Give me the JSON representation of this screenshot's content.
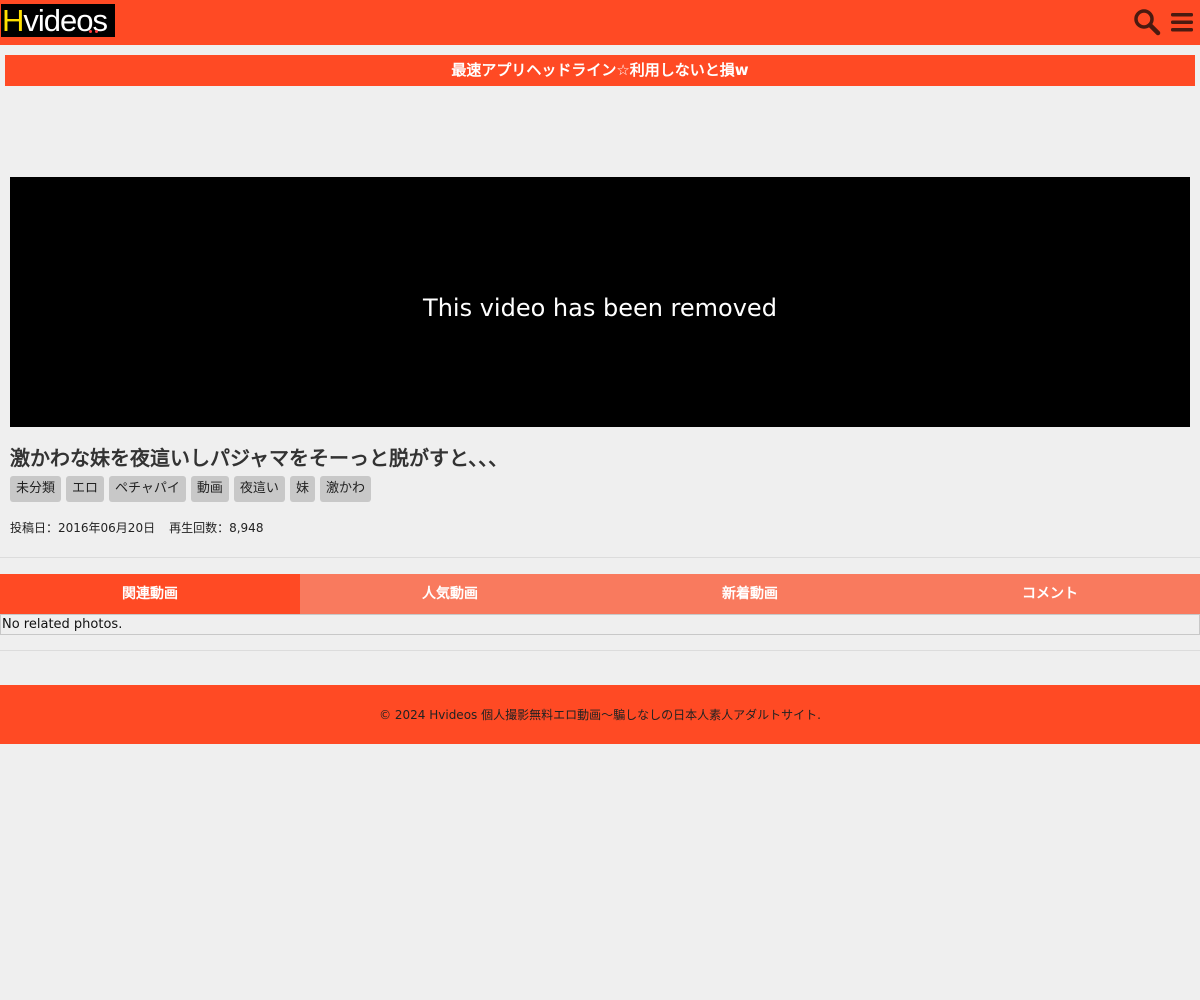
{
  "header": {
    "logo_h": "H",
    "logo_rest": "videos",
    "search_icon": "search-icon",
    "menu_icon": "hamburger-menu-icon",
    "brand_color": "#ff4a24"
  },
  "banner": {
    "text": "最速アプリヘッドライン☆利用しないと損w"
  },
  "player": {
    "message": "This video has been removed"
  },
  "video": {
    "title": "激かわな妹を夜這いしパジャマをそーっと脱がすと、、、",
    "tags": [
      "未分類",
      "エロ",
      "ペチャパイ",
      "動画",
      "夜這い",
      "妹",
      "激かわ"
    ],
    "posted_label": "投稿日：2016年06月20日",
    "views_label": "再生回数：8,948"
  },
  "tabs": [
    {
      "label": "関連動画",
      "active": true
    },
    {
      "label": "人気動画",
      "active": false
    },
    {
      "label": "新着動画",
      "active": false
    },
    {
      "label": "コメント",
      "active": false
    }
  ],
  "tab_content": {
    "empty_text": "No related photos."
  },
  "footer": {
    "text": "© 2024 Hvideos 個人撮影無料エロ動画〜騙しなしの日本人素人アダルトサイト."
  }
}
